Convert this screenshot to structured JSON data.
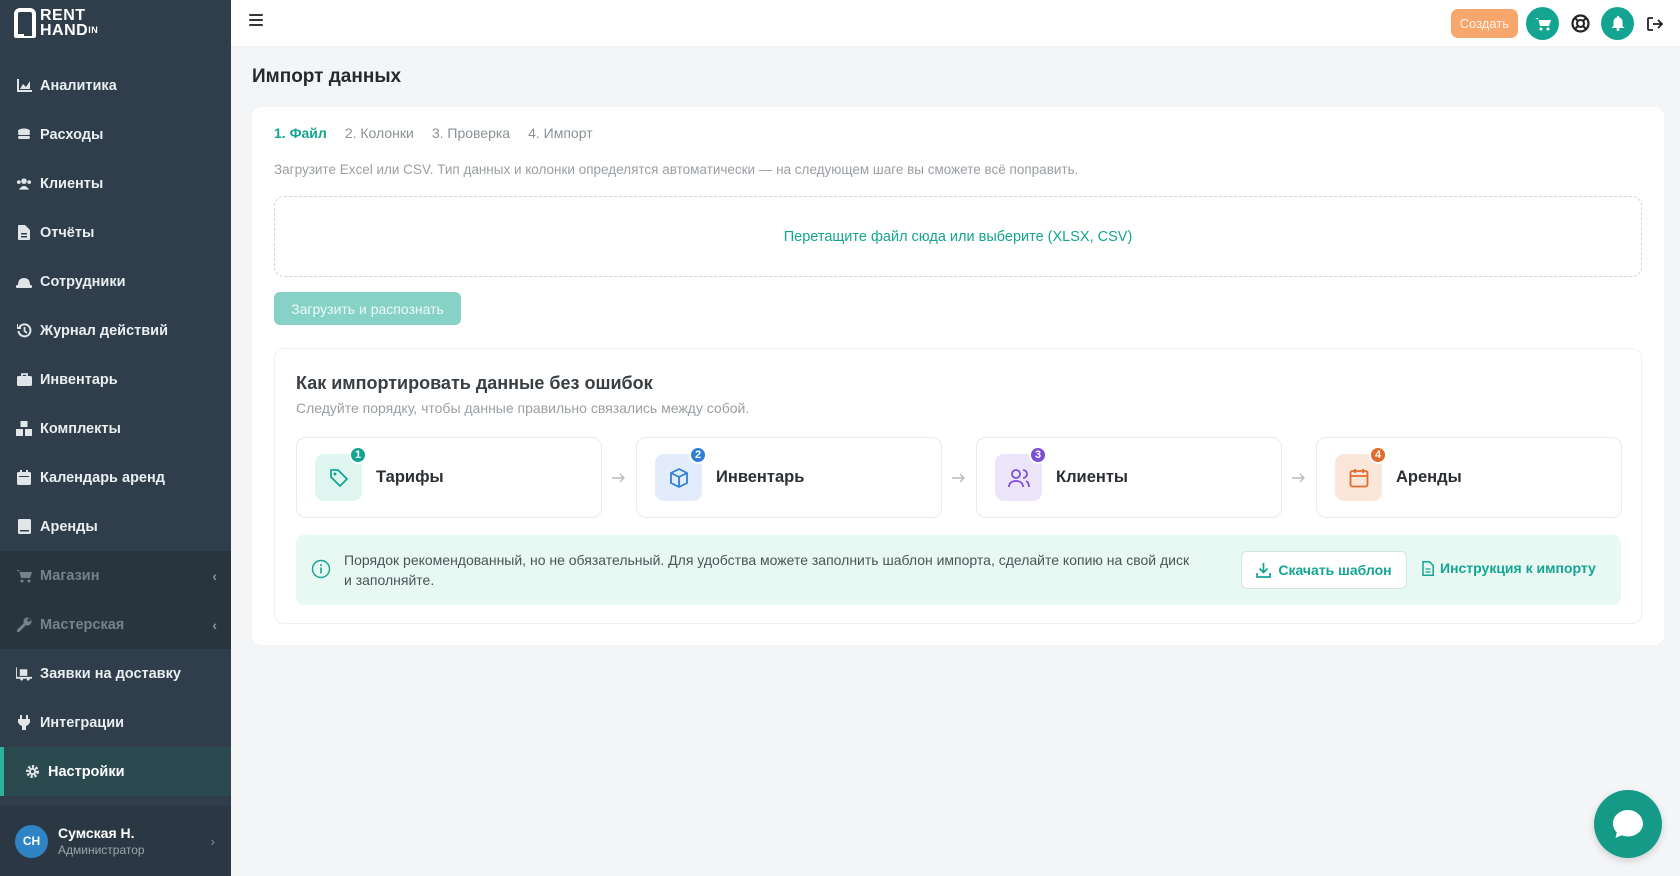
{
  "app": {
    "logo_line1": "RENT",
    "logo_line2": "HAND",
    "logo_in": "IN"
  },
  "sidebar": {
    "items": [
      {
        "label": "Аналитика",
        "icon": "chart-icon"
      },
      {
        "label": "Расходы",
        "icon": "coins-icon"
      },
      {
        "label": "Клиенты",
        "icon": "users-icon"
      },
      {
        "label": "Отчёты",
        "icon": "file-icon"
      },
      {
        "label": "Сотрудники",
        "icon": "hardhat-icon"
      },
      {
        "label": "Журнал действий",
        "icon": "history-icon"
      },
      {
        "label": "Инвентарь",
        "icon": "briefcase-icon"
      },
      {
        "label": "Комплекты",
        "icon": "boxes-icon"
      },
      {
        "label": "Календарь аренд",
        "icon": "calendar-icon"
      },
      {
        "label": "Аренды",
        "icon": "book-icon"
      },
      {
        "label": "Магазин",
        "icon": "cart-icon"
      },
      {
        "label": "Мастерская",
        "icon": "wrench-icon"
      },
      {
        "label": "Заявки на доставку",
        "icon": "truck-icon"
      },
      {
        "label": "Интеграции",
        "icon": "plug-icon"
      },
      {
        "label": "Настройки",
        "icon": "gear-icon"
      }
    ]
  },
  "user": {
    "initials": "СН",
    "name": "Сумская Н.",
    "role": "Администратор"
  },
  "topbar": {
    "create_label": "Создать"
  },
  "page": {
    "title": "Импорт данных",
    "steps": [
      "1. Файл",
      "2. Колонки",
      "3. Проверка",
      "4. Импорт"
    ],
    "hint": "Загрузите Excel или CSV. Тип данных и колонки определятся автоматически — на следующем шаге вы сможете всё поправить.",
    "dropzone": "Перетащите файл сюда или выберите (XLSX, CSV)",
    "upload_button": "Загрузить и распознать"
  },
  "guide": {
    "title": "Как импортировать данные без ошибок",
    "subtitle": "Следуйте порядку, чтобы данные правильно связались между собой.",
    "tiles": [
      {
        "num": "1",
        "label": "Тарифы",
        "icon": "tag-icon",
        "color": "#14a592",
        "bg": "#dff5ef"
      },
      {
        "num": "2",
        "label": "Инвентарь",
        "icon": "cube-icon",
        "color": "#2f7fd6",
        "bg": "#e2ecfa"
      },
      {
        "num": "3",
        "label": "Клиенты",
        "icon": "user-icon",
        "color": "#7a4fd6",
        "bg": "#ece5fa"
      },
      {
        "num": "4",
        "label": "Аренды",
        "icon": "calendar-icon",
        "color": "#e26a2c",
        "bg": "#fbe7d9"
      }
    ],
    "note": "Порядок рекомендованный, но не обязательный. Для удобства можете заполнить шаблон импорта, сделайте копию на свой диск и заполняйте.",
    "download_label": "Скачать шаблон",
    "instruction_label": "Инструкция к импорту"
  },
  "colors": {
    "accent": "#14a592",
    "sidebar": "#2f3e4a",
    "create": "#f7a66c"
  }
}
